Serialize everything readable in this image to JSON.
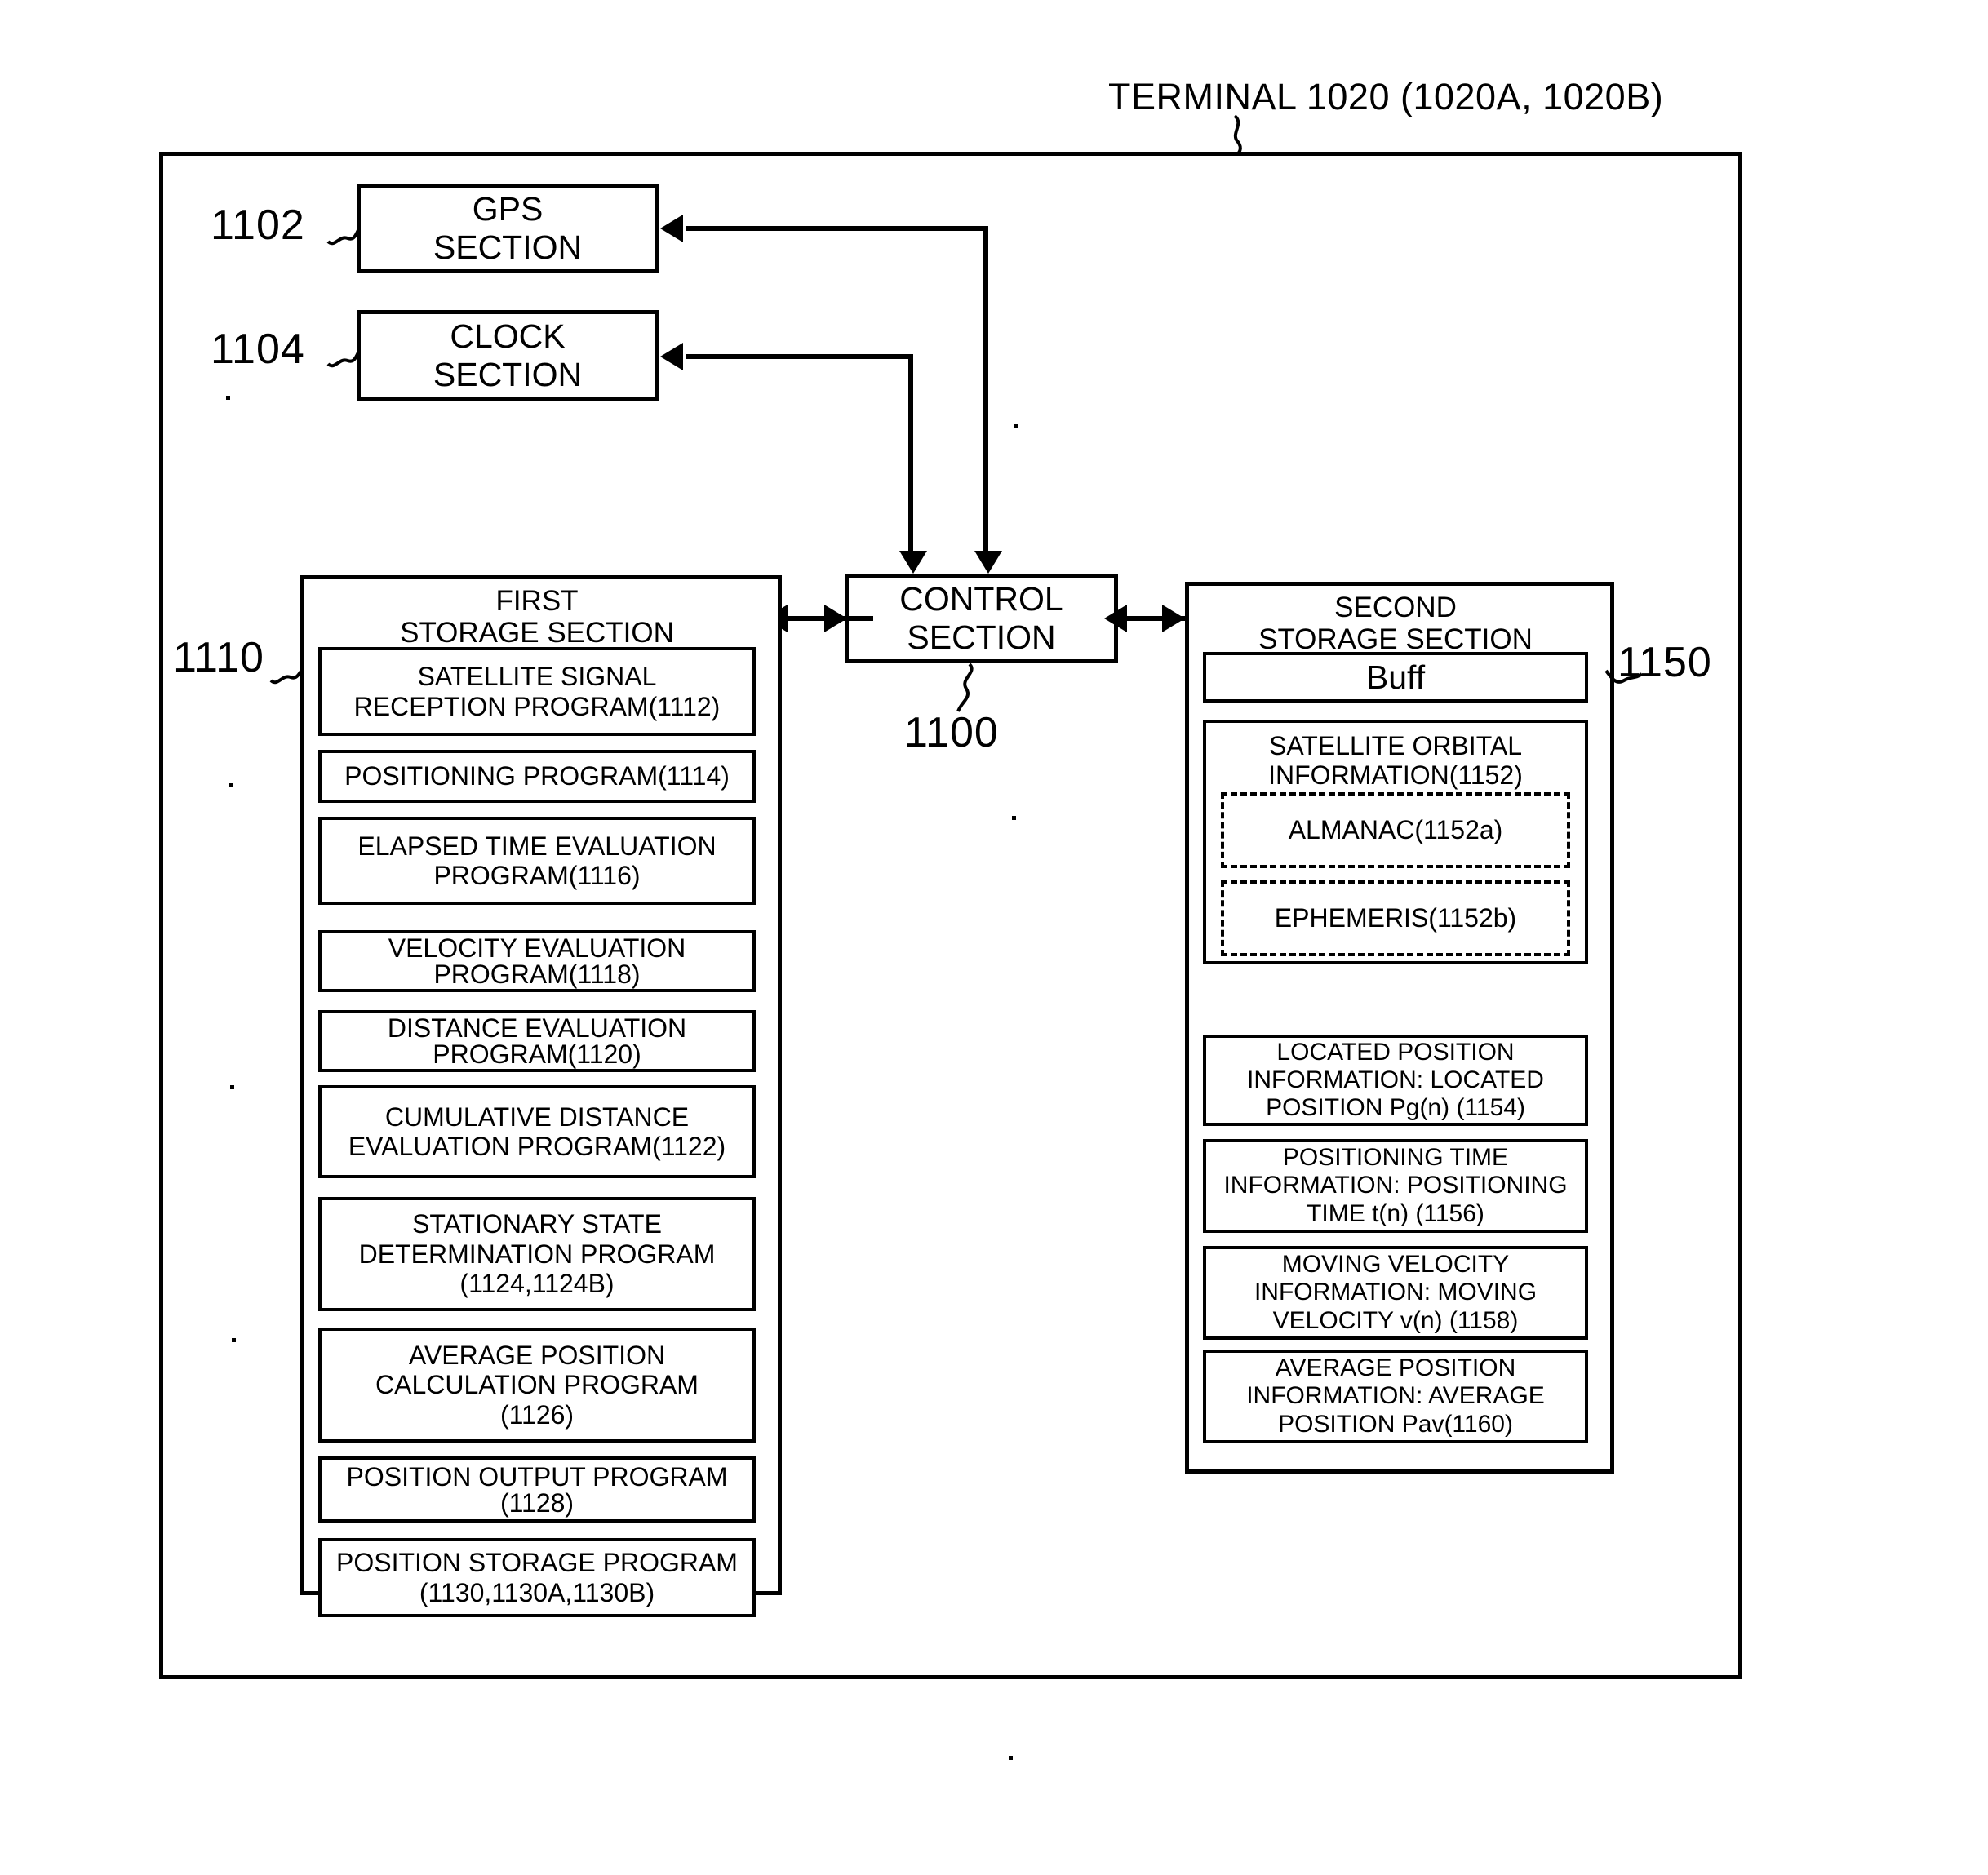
{
  "figure": {
    "title": "TERMINAL 1020 (1020A, 1020B)"
  },
  "blocks": {
    "gps_section": {
      "label": "GPS\nSECTION",
      "ref": "1102"
    },
    "clock_section": {
      "label": "CLOCK\nSECTION",
      "ref": "1104"
    },
    "control_section": {
      "label": "CONTROL\nSECTION",
      "ref": "1100"
    },
    "first_storage": {
      "label": "FIRST\nSTORAGE SECTION",
      "ref": "1110"
    },
    "second_storage": {
      "label": "SECOND\nSTORAGE SECTION",
      "ref": "1150"
    }
  },
  "first_storage_items": [
    {
      "label": "SATELLITE SIGNAL\nRECEPTION PROGRAM(1112)"
    },
    {
      "label": "POSITIONING PROGRAM(1114)"
    },
    {
      "label": "ELAPSED TIME EVALUATION\nPROGRAM(1116)"
    },
    {
      "label": "VELOCITY EVALUATION\nPROGRAM(1118)"
    },
    {
      "label": "DISTANCE EVALUATION\nPROGRAM(1120)"
    },
    {
      "label": "CUMULATIVE DISTANCE\nEVALUATION PROGRAM(1122)"
    },
    {
      "label": "STATIONARY STATE\nDETERMINATION PROGRAM\n(1124,1124B)"
    },
    {
      "label": "AVERAGE POSITION\nCALCULATION PROGRAM\n(1126)"
    },
    {
      "label": "POSITION OUTPUT PROGRAM\n(1128)"
    },
    {
      "label": "POSITION STORAGE PROGRAM\n(1130,1130A,1130B)"
    }
  ],
  "second_storage_items": {
    "buff": {
      "label": "Buff"
    },
    "satellite_orbital": {
      "label": "SATELLITE ORBITAL\nINFORMATION(1152)"
    },
    "almanac": {
      "label": "ALMANAC(1152a)"
    },
    "ephemeris": {
      "label": "EPHEMERIS(1152b)"
    },
    "located_position": {
      "label": "LOCATED POSITION\nINFORMATION: LOCATED\nPOSITION Pg(n) (1154)"
    },
    "positioning_time": {
      "label": "POSITIONING TIME\nINFORMATION: POSITIONING\nTIME t(n) (1156)"
    },
    "moving_velocity": {
      "label": "MOVING VELOCITY\nINFORMATION: MOVING\nVELOCITY v(n) (1158)"
    },
    "average_position": {
      "label": "AVERAGE POSITION\nINFORMATION: AVERAGE\nPOSITION Pav(1160)"
    }
  }
}
